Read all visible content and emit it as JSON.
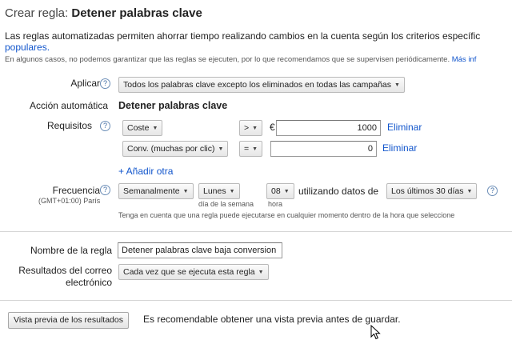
{
  "header": {
    "prefix": "Crear regla:",
    "rule_name": "Detener palabras clave"
  },
  "intro": {
    "text": "Las reglas automatizadas permiten ahorrar tiempo realizando cambios en la cuenta según los criterios específic",
    "link_tail": "populares.",
    "note": "En algunos casos, no podemos garantizar que las reglas se ejecuten, por lo que recomendamos que se supervisen periódicamente.",
    "note_link": "Más inf"
  },
  "apply_to": {
    "label": "Aplicar a",
    "value": "Todos los palabras clave excepto los eliminados en todas las campañas"
  },
  "automatic_action": {
    "label": "Acción automática",
    "value": "Detener palabras clave"
  },
  "requirements": {
    "label": "Requisitos",
    "rows": [
      {
        "metric": "Coste",
        "operator": ">",
        "currency": "€",
        "value": "1000",
        "remove": "Eliminar"
      },
      {
        "metric": "Conv. (muchas por clic)",
        "operator": "=",
        "currency": "",
        "value": "0",
        "remove": "Eliminar"
      }
    ],
    "add_label": "+ Añadir otra"
  },
  "frequency": {
    "label": "Frecuencia",
    "timezone": "(GMT+01:00) París",
    "period": "Semanalmente",
    "day": "Lunes",
    "day_caption": "día de la semana",
    "hour": "08",
    "hour_caption": "hora",
    "using_data_label": "utilizando datos de",
    "range": "Los últimos 30 días",
    "hint": "Tenga en cuenta que una regla puede ejecutarse en cualquier momento dentro de la hora que seleccione"
  },
  "rule_name": {
    "label": "Nombre de la regla",
    "value": "Detener palabras clave baja conversion"
  },
  "email": {
    "label_line1": "Resultados del correo",
    "label_line2": "electrónico",
    "value": "Cada vez que se ejecuta esta regla"
  },
  "preview": {
    "button": "Vista previa de los resultados",
    "hint": "Es recomendable obtener una vista previa antes de guardar."
  },
  "icons": {
    "help": "?",
    "dropdown": "▼"
  },
  "colors": {
    "link": "#1155cc",
    "help_border": "#6d8fb8"
  }
}
